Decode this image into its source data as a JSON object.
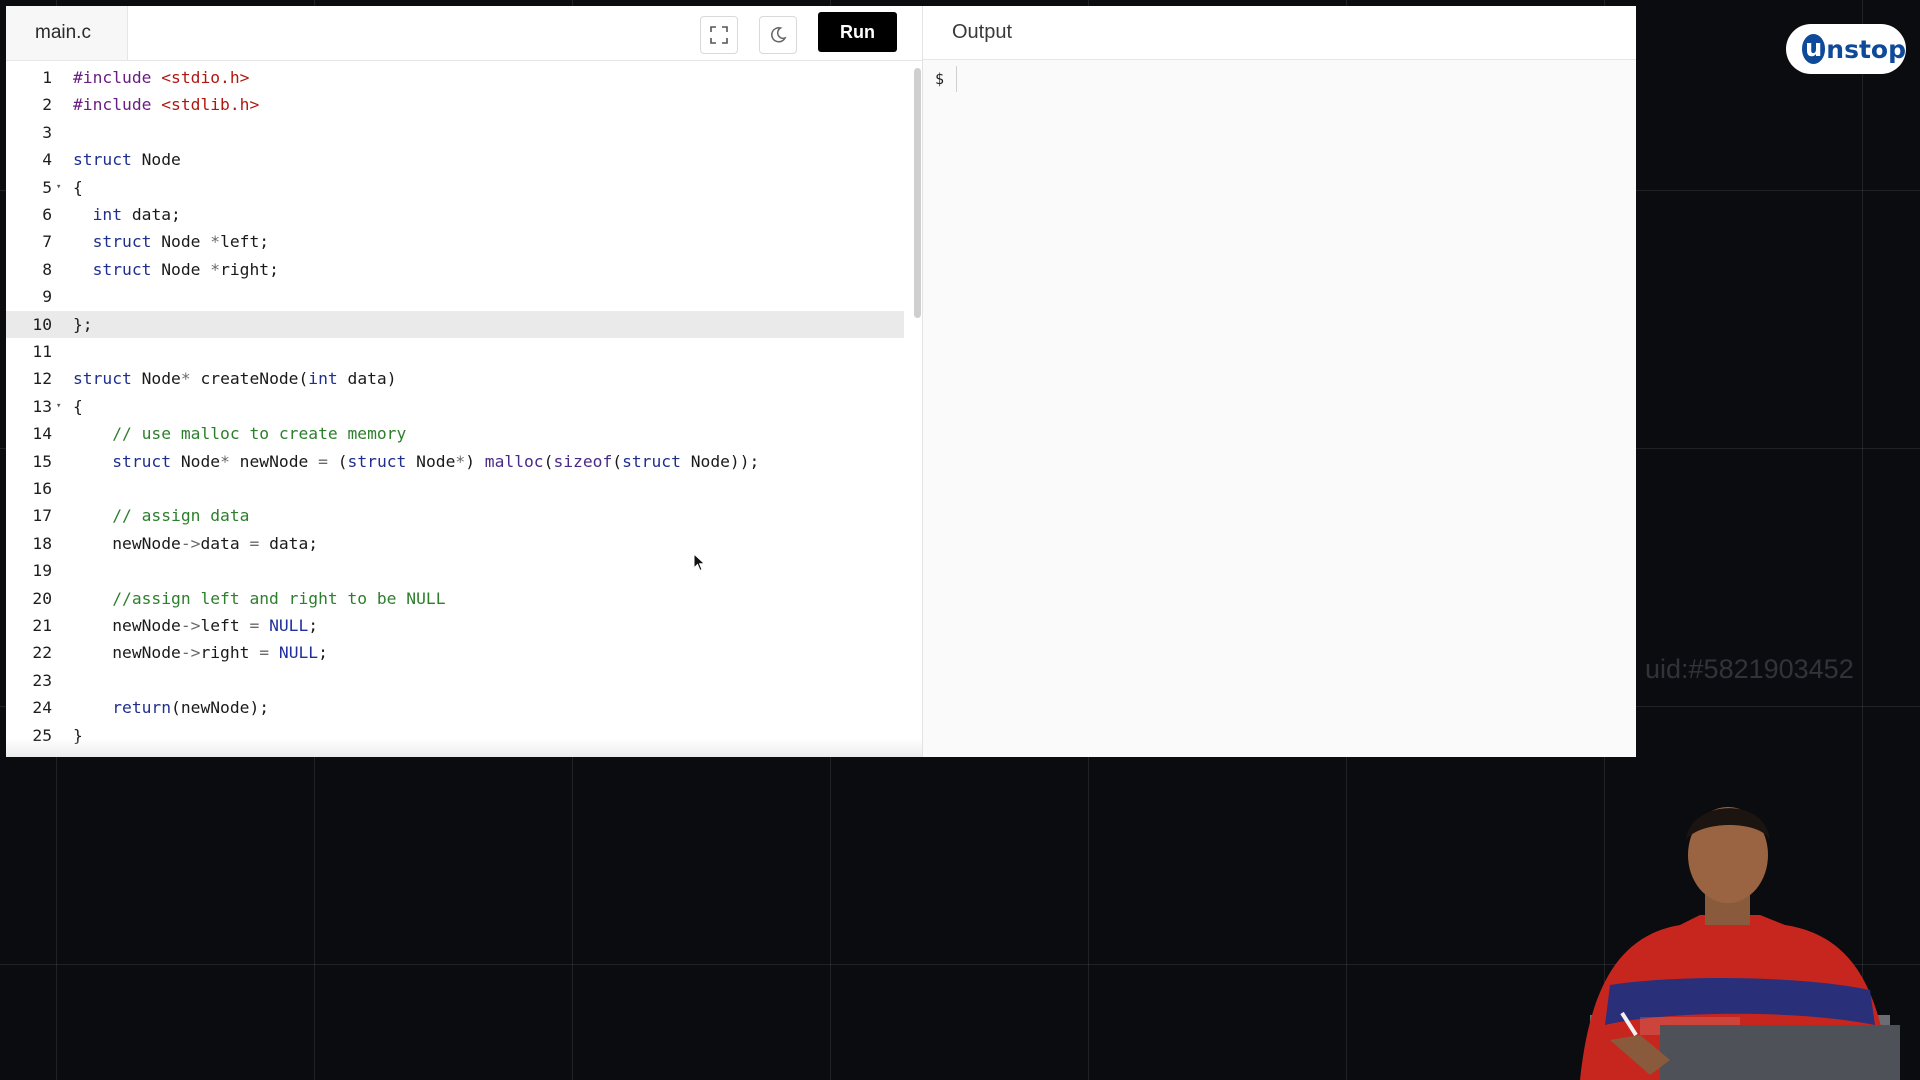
{
  "editor": {
    "file_tab": "main.c",
    "fullscreen_icon": "fullscreen-icon",
    "theme_icon": "moon-icon",
    "run_label": "Run",
    "active_line": 10,
    "lines": [
      {
        "n": "1",
        "fold": "",
        "html": "<span class=\"pre\">#include</span> <span class=\"str\">&lt;stdio.h&gt;</span>"
      },
      {
        "n": "2",
        "fold": "",
        "html": "<span class=\"pre\">#include</span> <span class=\"str\">&lt;stdlib.h&gt;</span>"
      },
      {
        "n": "3",
        "fold": "",
        "html": ""
      },
      {
        "n": "4",
        "fold": "",
        "html": "<span class=\"kw\">struct</span> Node"
      },
      {
        "n": "5",
        "fold": "▾",
        "html": "{"
      },
      {
        "n": "6",
        "fold": "",
        "html": "  <span class=\"kw\">int</span> data;"
      },
      {
        "n": "7",
        "fold": "",
        "html": "  <span class=\"kw\">struct</span> Node <span class=\"op\">*</span>left;"
      },
      {
        "n": "8",
        "fold": "",
        "html": "  <span class=\"kw\">struct</span> Node <span class=\"op\">*</span>right;"
      },
      {
        "n": "9",
        "fold": "",
        "html": ""
      },
      {
        "n": "10",
        "fold": "",
        "html": "};"
      },
      {
        "n": "11",
        "fold": "",
        "html": ""
      },
      {
        "n": "12",
        "fold": "",
        "html": "<span class=\"kw\">struct</span> Node<span class=\"op\">*</span> createNode(<span class=\"kw\">int</span> data)"
      },
      {
        "n": "13",
        "fold": "▾",
        "html": "{"
      },
      {
        "n": "14",
        "fold": "",
        "html": "    <span class=\"cm\">// use malloc to create memory</span>"
      },
      {
        "n": "15",
        "fold": "",
        "html": "    <span class=\"kw\">struct</span> Node<span class=\"op\">*</span> newNode <span class=\"op\">=</span> (<span class=\"kw\">struct</span> Node<span class=\"op\">*</span>) <span class=\"fn\">malloc</span>(<span class=\"fn\">sizeof</span>(<span class=\"kw\">struct</span> Node));"
      },
      {
        "n": "16",
        "fold": "",
        "html": ""
      },
      {
        "n": "17",
        "fold": "",
        "html": "    <span class=\"cm\">// assign data</span>"
      },
      {
        "n": "18",
        "fold": "",
        "html": "    newNode<span class=\"op\">-&gt;</span>data <span class=\"op\">=</span> data;"
      },
      {
        "n": "19",
        "fold": "",
        "html": ""
      },
      {
        "n": "20",
        "fold": "",
        "html": "    <span class=\"cm\">//assign left and right to be NULL</span>"
      },
      {
        "n": "21",
        "fold": "",
        "html": "    newNode<span class=\"op\">-&gt;</span>left <span class=\"op\">=</span> <span class=\"nl\">NULL</span>;"
      },
      {
        "n": "22",
        "fold": "",
        "html": "    newNode<span class=\"op\">-&gt;</span>right <span class=\"op\">=</span> <span class=\"nl\">NULL</span>;"
      },
      {
        "n": "23",
        "fold": "",
        "html": ""
      },
      {
        "n": "24",
        "fold": "",
        "html": "    <span class=\"kw\">return</span>(newNode);"
      },
      {
        "n": "25",
        "fold": "",
        "html": "}"
      }
    ]
  },
  "output": {
    "title": "Output",
    "prompt": "$"
  },
  "overlay": {
    "logo_u": "un",
    "logo_rest": "stop",
    "uid": "uid:#5821903452"
  }
}
